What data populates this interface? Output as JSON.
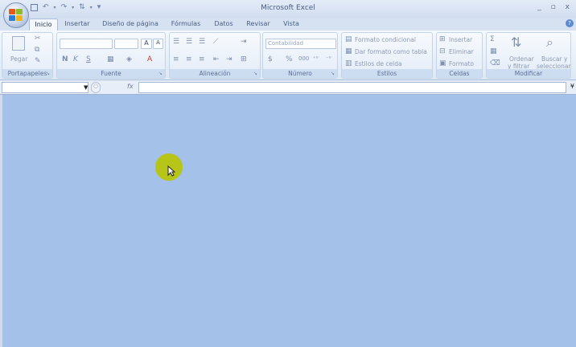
{
  "window": {
    "title": "Microsoft Excel",
    "controls": [
      "_",
      "▫",
      "x"
    ]
  },
  "quick_access": {
    "save_icon": "save-icon",
    "undo_icon": "undo-icon",
    "redo_icon": "redo-icon",
    "customize": "▾"
  },
  "tabs": [
    "Inicio",
    "Insertar",
    "Diseño de página",
    "Fórmulas",
    "Datos",
    "Revisar",
    "Vista"
  ],
  "ribbon": {
    "portapapeles": {
      "label": "Portapapeles",
      "paste": "Pegar"
    },
    "fuente": {
      "label": "Fuente",
      "font_name": "",
      "font_size": "",
      "grow": "A",
      "shrink": "A",
      "bold": "N",
      "italic": "K",
      "underline": "S"
    },
    "alineacion": {
      "label": "Alineación"
    },
    "numero": {
      "label": "Número",
      "format": "Contabilidad",
      "currency": "$",
      "percent": "%",
      "thousands": "000"
    },
    "estilos": {
      "label": "Estilos",
      "cond": "Formato condicional",
      "table": "Dar formato como tabla",
      "cell": "Estilos de celda"
    },
    "celdas": {
      "label": "Celdas",
      "insert": "Insertar",
      "delete": "Eliminar",
      "format": "Formato"
    },
    "modificar": {
      "label": "Modificar",
      "sort1": "Ordenar",
      "sort2": "y filtrar",
      "find1": "Buscar y",
      "find2": "seleccionar",
      "sigma": "Σ"
    }
  },
  "formula_bar": {
    "name_box": "",
    "fx": "fx",
    "formula": ""
  },
  "help": "?"
}
